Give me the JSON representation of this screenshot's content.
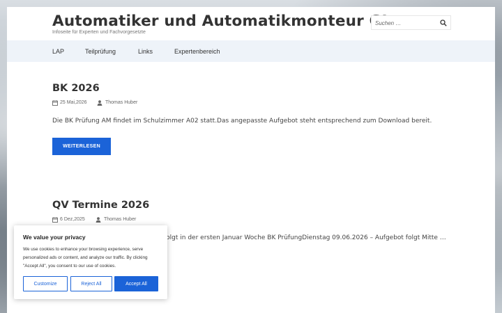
{
  "header": {
    "site_title": "Automatiker und Automatikmonteur GL",
    "tagline": "Infoseite für Experten und Fachvorgesetzte"
  },
  "search": {
    "placeholder": "Suchen …",
    "icon": "search-icon"
  },
  "nav": {
    "items": [
      {
        "label": "LAP"
      },
      {
        "label": "Teilprüfung"
      },
      {
        "label": "Links"
      },
      {
        "label": "Expertenbereich"
      }
    ]
  },
  "posts": [
    {
      "title": "BK 2026",
      "date": "25 Mai,2026",
      "author": "Thomas Huber",
      "excerpt": "Die BK Prüfung AM findet im Schulzimmer A02 statt.Das angepasste Aufgebot steht entsprechend zum Download bereit.",
      "read_more": "WEITERLESEN"
    },
    {
      "title": "QV Termine 2026",
      "date": "6 Dez,2025",
      "author": "Thomas Huber",
      "excerpt": "folgt in der ersten Januar Woche BK PrüfungDienstag 09.06.2026 – Aufgebot folgt Mitte …"
    }
  ],
  "cookie_banner": {
    "title": "We value your privacy",
    "text": "We use cookies to enhance your browsing experience, serve personalized ads or content, and analyze our traffic. By clicking \"Accept All\", you consent to our use of cookies.",
    "customize": "Customize",
    "reject": "Reject All",
    "accept": "Accept All"
  },
  "colors": {
    "accent": "#1b63d8",
    "nav_background": "#eef3f9"
  }
}
